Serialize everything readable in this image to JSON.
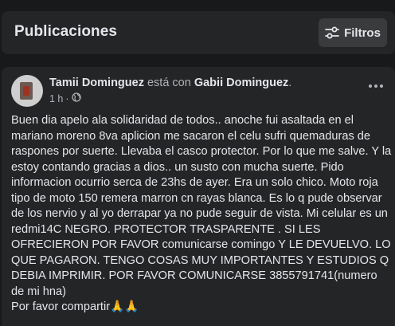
{
  "header": {
    "title": "Publicaciones",
    "filter_label": "Filtros",
    "filter_icon": "sliders-icon"
  },
  "post": {
    "author": "Tamii Dominguez",
    "connector": " está con ",
    "tagged": "Gabii Dominguez",
    "tagged_suffix": ".",
    "time": "1 h",
    "separator": "·",
    "privacy_icon": "globe-icon",
    "more_icon": "more-dots-icon",
    "body": "Buen dia apelo ala solidaridad de todos.. anoche fui asaltada en el mariano moreno 8va aplicion me sacaron el celu sufri quemaduras de raspones   por suerte. Llevaba el casco protector. Por lo que me salve. Y la estoy contando gracias a dios.. un susto con mucha suerte. Pido informacion ocurrio serca de 23hs de ayer. Era un solo chico. Moto roja tipo de moto 150 remera marron cn rayas blanca.  Es lo q pude observar de los nervio y al yo  derrapar ya no pude seguir de vista. Mi celular es un redmi14C NEGRO. PROTECTOR TRASPARENTE . SI LES OFRECIERON POR FAVOR comunicarse comingo  Y  LE DEVUELVO.   LO QUE PAGARON. TENGO COSAS MUY IMPORTANTES Y ESTUDIOS Q DEBIA IMPRIMIR. POR FAVOR COMUNICARSE  3855791741(numero de mi hna)",
    "share_line": "Por favor compartir🙏🙏"
  },
  "colors": {
    "background": "#18191a",
    "card": "#242526",
    "button": "#3a3b3c",
    "primary_text": "#e4e6eb",
    "secondary_text": "#b0b3b8"
  }
}
